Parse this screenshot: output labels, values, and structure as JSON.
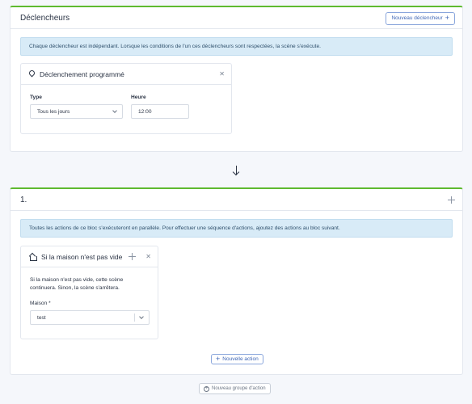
{
  "triggers": {
    "title": "Déclencheurs",
    "new_button": "Nouveau déclencheur",
    "info": "Chaque déclencheur est indépendant. Lorsque les conditions de l'un ces déclencheurs sont respectées, la scène s'exécute.",
    "scheduled": {
      "title": "Déclenchement programmé",
      "type_label": "Type",
      "type_value": "Tous les jours",
      "hour_label": "Heure",
      "hour_value": "12:00"
    }
  },
  "action_group": {
    "title": "1.",
    "info": "Toutes les actions de ce bloc s'exécuteront en parallèle. Pour effectuer une séquence d'actions, ajoutez des actions au bloc suivant.",
    "condition": {
      "title": "Si la maison n'est pas vide",
      "description": "Si la maison n'est pas vide, cette scène continuera. Sinon, la scène s'arrêtera.",
      "house_label": "Maison *",
      "house_value": "test"
    },
    "new_action_button": "Nouvelle action"
  },
  "new_group_button": "Nouveau groupe d'action",
  "icons": [
    "plus-icon",
    "pin-icon",
    "close-icon",
    "chevron-down-icon",
    "arrow-down-icon",
    "drag-icon",
    "home-icon",
    "plus-circle-icon"
  ],
  "colors": {
    "accent_green": "#5eba2f",
    "info_bg": "#d8ebf7",
    "link_blue": "#3f67b6"
  }
}
